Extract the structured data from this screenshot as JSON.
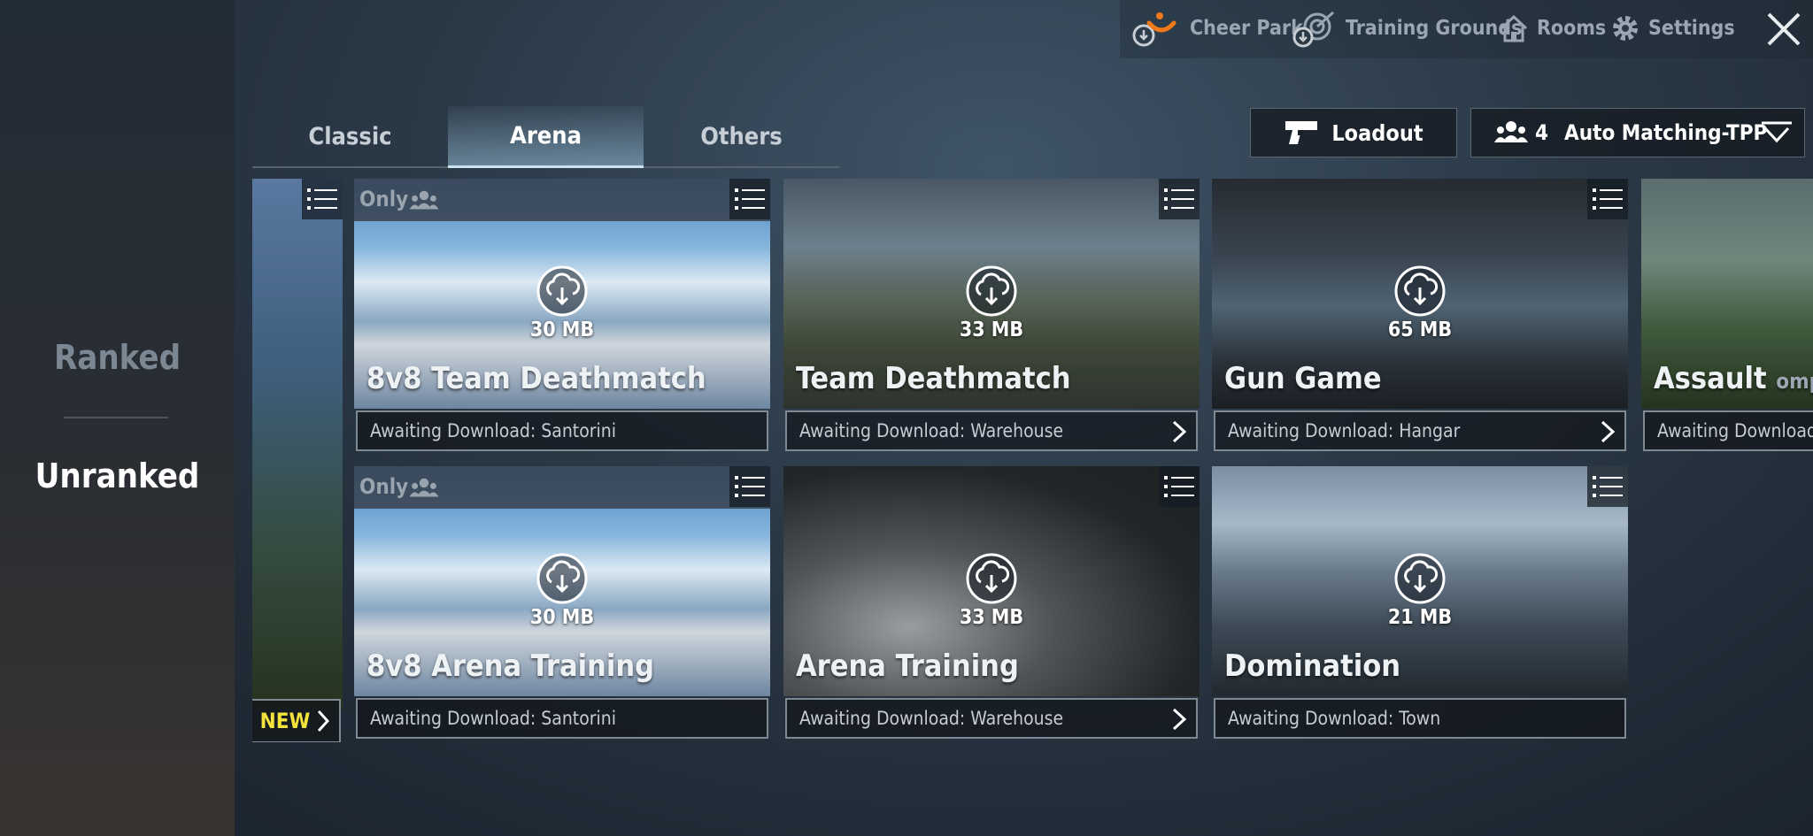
{
  "sidebar": {
    "ranked": "Ranked",
    "unranked": "Unranked"
  },
  "topbar": {
    "cheer_park": "Cheer Park",
    "training_grounds": "Training Grounds",
    "rooms": "Rooms",
    "settings": "Settings"
  },
  "tabs": [
    "Classic",
    "Arena",
    "Others"
  ],
  "active_tab": "Arena",
  "buttons": {
    "loadout": "Loadout",
    "squad_count": "4",
    "matching": "Auto Matching-TPP"
  },
  "new_badge": "NEW",
  "only_label": "Only",
  "cards": [
    {
      "title": "8v8 Team Deathmatch",
      "size": "30 MB",
      "status": "Awaiting Download: Santorini"
    },
    {
      "title": "Team Deathmatch",
      "size": "33 MB",
      "status": "Awaiting Download: Warehouse"
    },
    {
      "title": "Gun Game",
      "size": "65 MB",
      "status": "Awaiting Download: Hangar"
    },
    {
      "title": "Assault",
      "suffix": "omplex",
      "status": "Awaiting Download: I"
    },
    {
      "title": "8v8 Arena Training",
      "size": "30 MB",
      "status": "Awaiting Download: Santorini"
    },
    {
      "title": "Arena Training",
      "size": "33 MB",
      "status": "Awaiting Download: Warehouse"
    },
    {
      "title": "Domination",
      "size": "21 MB",
      "status": "Awaiting Download: Town"
    }
  ],
  "colors": {
    "accent_tab": "#c9e3f3",
    "new_badge": "#f3e33a",
    "cheer_park_icon": "#f07a1a"
  }
}
